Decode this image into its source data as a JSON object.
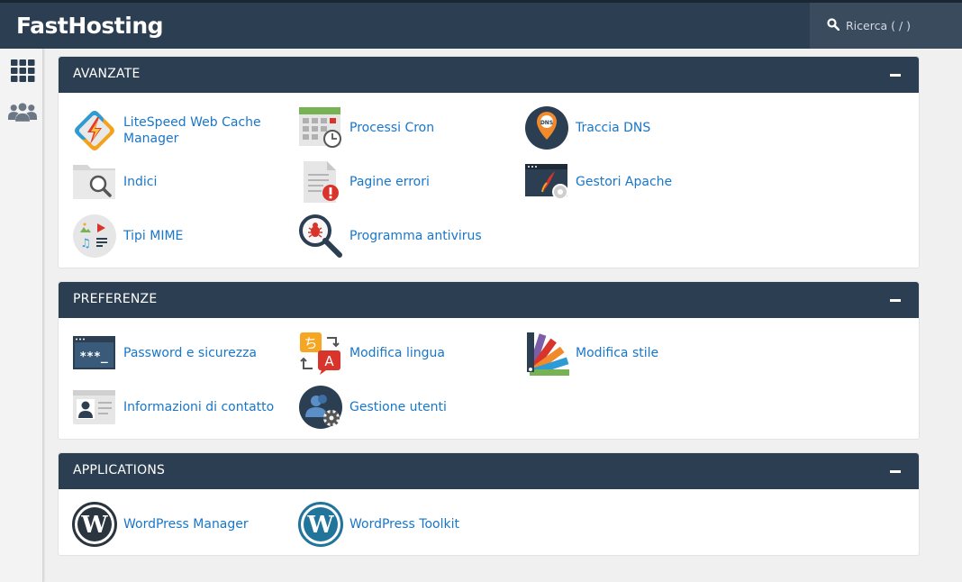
{
  "brand": "FastHosting",
  "search": {
    "placeholder": "Ricerca ( / )"
  },
  "sidebar": {
    "icons": [
      "apps-grid-icon",
      "users-icon"
    ]
  },
  "panels": [
    {
      "title": "AVANZATE",
      "items": [
        {
          "label_line1": "LiteSpeed Web Cache",
          "label_line2": "Manager",
          "icon": "litespeed-icon"
        },
        {
          "label": "Processi Cron",
          "icon": "calendar-clock-icon"
        },
        {
          "label": "Traccia DNS",
          "icon": "dns-pin-icon"
        },
        {
          "label": "Indici",
          "icon": "folder-search-icon"
        },
        {
          "label": "Pagine errori",
          "icon": "error-page-icon"
        },
        {
          "label": "Gestori Apache",
          "icon": "apache-handler-icon"
        },
        {
          "label": "Tipi MIME",
          "icon": "mime-types-icon"
        },
        {
          "label": "Programma antivirus",
          "icon": "virus-scan-icon"
        }
      ]
    },
    {
      "title": "PREFERENZE",
      "items": [
        {
          "label": "Password e sicurezza",
          "icon": "password-icon"
        },
        {
          "label": "Modifica lingua",
          "icon": "language-icon"
        },
        {
          "label": "Modifica stile",
          "icon": "color-palette-icon"
        },
        {
          "label": "Informazioni di contatto",
          "icon": "contact-card-icon"
        },
        {
          "label": "Gestione utenti",
          "icon": "user-manager-icon"
        }
      ]
    },
    {
      "title": "APPLICATIONS",
      "items": [
        {
          "label": "WordPress Manager",
          "icon": "wordpress-dark-icon"
        },
        {
          "label": "WordPress Toolkit",
          "icon": "wordpress-blue-icon"
        }
      ]
    }
  ],
  "colors": {
    "header": "#2c3e52",
    "link": "#1976c8",
    "background": "#f0f0f0"
  }
}
